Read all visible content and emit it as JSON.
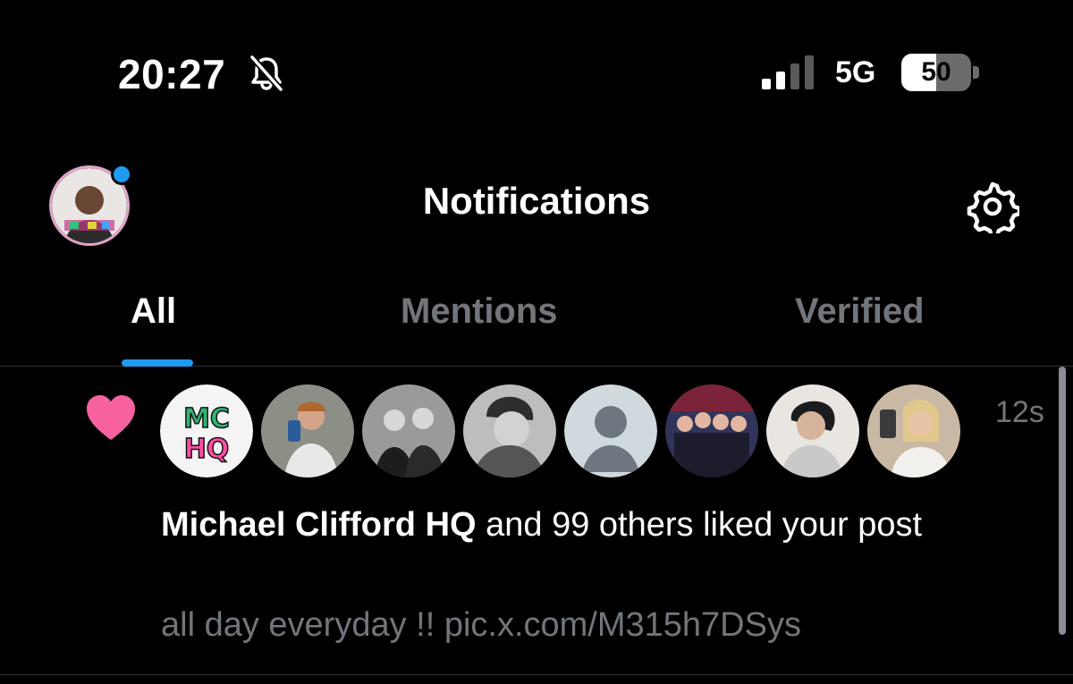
{
  "status_bar": {
    "time": "20:27",
    "network": "5G",
    "battery_level": "50",
    "battery_fraction": 0.5,
    "signal_bars_active": 2,
    "signal_bars_total": 4,
    "icons": [
      "bell-slash-icon",
      "signal-icon",
      "battery-icon"
    ]
  },
  "header": {
    "title": "Notifications",
    "icons": [
      "profile-avatar",
      "gear-icon"
    ],
    "accent": "#1d9bf0"
  },
  "tabs": [
    {
      "label": "All",
      "active": true
    },
    {
      "label": "Mentions",
      "active": false
    },
    {
      "label": "Verified",
      "active": false
    }
  ],
  "notification": {
    "icon": "heart-icon",
    "heart_color": "#f7629f",
    "avatar_count": 8,
    "timestamp": "12s",
    "actor": "Michael Clifford HQ",
    "action_text": " and 99 others liked your post",
    "post_preview": "all day everyday !! pic.x.com/M315h7DSys",
    "avatar_logo_text": "MC HQ"
  }
}
